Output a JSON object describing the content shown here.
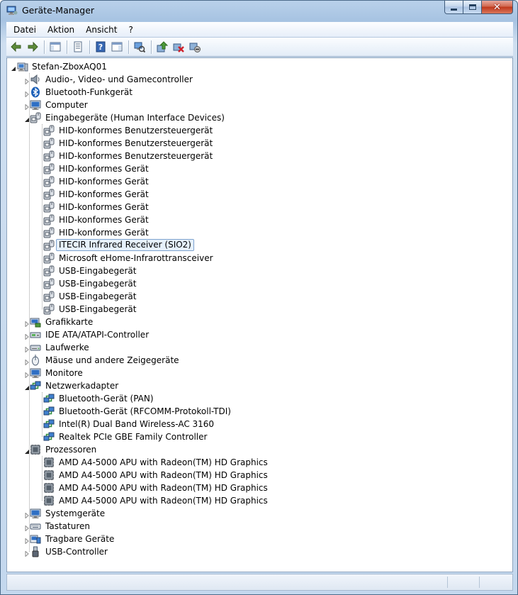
{
  "window": {
    "title": "Geräte-Manager"
  },
  "menu": [
    {
      "label": "Datei"
    },
    {
      "label": "Aktion"
    },
    {
      "label": "Ansicht"
    },
    {
      "label": "?"
    }
  ],
  "toolbar": [
    {
      "icon": "back-arrow-icon",
      "name": "back-button"
    },
    {
      "icon": "forward-arrow-icon",
      "name": "forward-button"
    },
    {
      "sep": true
    },
    {
      "icon": "console-tree-icon",
      "name": "show-hide-console-tree-button"
    },
    {
      "sep": true
    },
    {
      "icon": "properties-icon",
      "name": "properties-button"
    },
    {
      "sep": true
    },
    {
      "icon": "help-icon",
      "name": "help-button"
    },
    {
      "icon": "action-pane-icon",
      "name": "show-hide-action-pane-button"
    },
    {
      "sep": true
    },
    {
      "icon": "scan-hardware-icon",
      "name": "scan-hardware-button"
    },
    {
      "sep": true
    },
    {
      "icon": "update-driver-icon",
      "name": "update-driver-button"
    },
    {
      "icon": "uninstall-device-icon",
      "name": "uninstall-device-button"
    },
    {
      "icon": "disable-device-icon",
      "name": "disable-device-button"
    }
  ],
  "tree": [
    {
      "level": 0,
      "label": "Stefan-ZboxAQ01",
      "icon": "computer",
      "exp": "open"
    },
    {
      "level": 1,
      "label": "Audio-, Video- und Gamecontroller",
      "icon": "speaker",
      "exp": "closed"
    },
    {
      "level": 1,
      "label": "Bluetooth-Funkgerät",
      "icon": "bluetooth",
      "exp": "closed"
    },
    {
      "level": 1,
      "label": "Computer",
      "icon": "monitor",
      "exp": "closed"
    },
    {
      "level": 1,
      "label": "Eingabegeräte (Human Interface Devices)",
      "icon": "hid",
      "exp": "open"
    },
    {
      "level": 2,
      "label": "HID-konformes Benutzersteuergerät",
      "icon": "hid"
    },
    {
      "level": 2,
      "label": "HID-konformes Benutzersteuergerät",
      "icon": "hid"
    },
    {
      "level": 2,
      "label": "HID-konformes Benutzersteuergerät",
      "icon": "hid"
    },
    {
      "level": 2,
      "label": "HID-konformes Gerät",
      "icon": "hid"
    },
    {
      "level": 2,
      "label": "HID-konformes Gerät",
      "icon": "hid"
    },
    {
      "level": 2,
      "label": "HID-konformes Gerät",
      "icon": "hid"
    },
    {
      "level": 2,
      "label": "HID-konformes Gerät",
      "icon": "hid"
    },
    {
      "level": 2,
      "label": "HID-konformes Gerät",
      "icon": "hid"
    },
    {
      "level": 2,
      "label": "HID-konformes Gerät",
      "icon": "hid"
    },
    {
      "level": 2,
      "label": "ITECIR Infrared Receiver (SIO2)",
      "icon": "hid",
      "selected": true
    },
    {
      "level": 2,
      "label": "Microsoft eHome-Infrarottransceiver",
      "icon": "hid"
    },
    {
      "level": 2,
      "label": "USB-Eingabegerät",
      "icon": "hid"
    },
    {
      "level": 2,
      "label": "USB-Eingabegerät",
      "icon": "hid"
    },
    {
      "level": 2,
      "label": "USB-Eingabegerät",
      "icon": "hid"
    },
    {
      "level": 2,
      "label": "USB-Eingabegerät",
      "icon": "hid"
    },
    {
      "level": 1,
      "label": "Grafikkarte",
      "icon": "display-adapter",
      "exp": "closed"
    },
    {
      "level": 1,
      "label": "IDE ATA/ATAPI-Controller",
      "icon": "ide",
      "exp": "closed"
    },
    {
      "level": 1,
      "label": "Laufwerke",
      "icon": "disk",
      "exp": "closed"
    },
    {
      "level": 1,
      "label": "Mäuse und andere Zeigegeräte",
      "icon": "mouse",
      "exp": "closed"
    },
    {
      "level": 1,
      "label": "Monitore",
      "icon": "monitor",
      "exp": "closed"
    },
    {
      "level": 1,
      "label": "Netzwerkadapter",
      "icon": "network",
      "exp": "open"
    },
    {
      "level": 2,
      "label": "Bluetooth-Gerät (PAN)",
      "icon": "network"
    },
    {
      "level": 2,
      "label": "Bluetooth-Gerät (RFCOMM-Protokoll-TDI)",
      "icon": "network"
    },
    {
      "level": 2,
      "label": "Intel(R) Dual Band Wireless-AC 3160",
      "icon": "network"
    },
    {
      "level": 2,
      "label": "Realtek PCIe GBE Family Controller",
      "icon": "network"
    },
    {
      "level": 1,
      "label": "Prozessoren",
      "icon": "cpu",
      "exp": "open"
    },
    {
      "level": 2,
      "label": "AMD A4-5000 APU with Radeon(TM) HD Graphics",
      "icon": "cpu"
    },
    {
      "level": 2,
      "label": "AMD A4-5000 APU with Radeon(TM) HD Graphics",
      "icon": "cpu"
    },
    {
      "level": 2,
      "label": "AMD A4-5000 APU with Radeon(TM) HD Graphics",
      "icon": "cpu"
    },
    {
      "level": 2,
      "label": "AMD A4-5000 APU with Radeon(TM) HD Graphics",
      "icon": "cpu"
    },
    {
      "level": 1,
      "label": "Systemgeräte",
      "icon": "monitor",
      "exp": "closed"
    },
    {
      "level": 1,
      "label": "Tastaturen",
      "icon": "keyboard",
      "exp": "closed"
    },
    {
      "level": 1,
      "label": "Tragbare Geräte",
      "icon": "portable",
      "exp": "closed"
    },
    {
      "level": 1,
      "label": "USB-Controller",
      "icon": "usb",
      "exp": "closed"
    }
  ]
}
